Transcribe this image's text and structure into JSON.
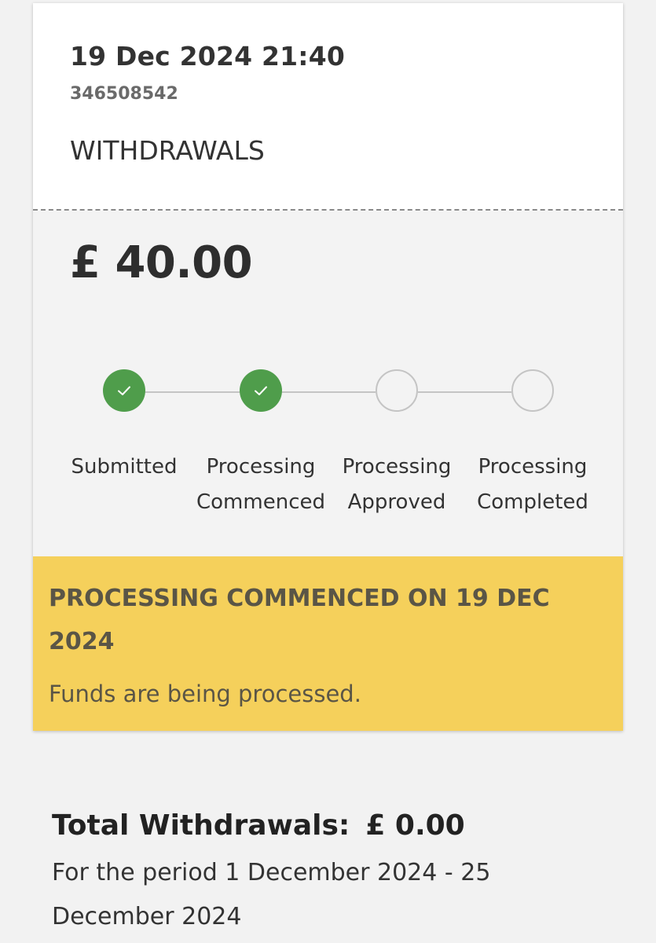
{
  "transaction": {
    "datetime": "19 Dec 2024 21:40",
    "reference": "346508542",
    "type": "WITHDRAWALS",
    "amount": "£ 40.00"
  },
  "progress": {
    "steps": [
      {
        "line1": "Submitted",
        "line2": "",
        "completed": true
      },
      {
        "line1": "Processing",
        "line2": "Commenced",
        "completed": true
      },
      {
        "line1": "Processing",
        "line2": "Approved",
        "completed": false
      },
      {
        "line1": "Processing",
        "line2": "Completed",
        "completed": false
      }
    ],
    "icon": "checkmark-icon",
    "colors": {
      "done": "#4f9d4b",
      "pending_border": "#c4c4c4"
    }
  },
  "status_banner": {
    "title": "PROCESSING COMMENCED ON 19 DEC 2024",
    "message": "Funds are being processed.",
    "color": "#f5d05b"
  },
  "summary": {
    "total_label": "Total Withdrawals:",
    "total_value": "£ 0.00",
    "period": "For the period 1 December 2024 - 25 December 2024"
  }
}
